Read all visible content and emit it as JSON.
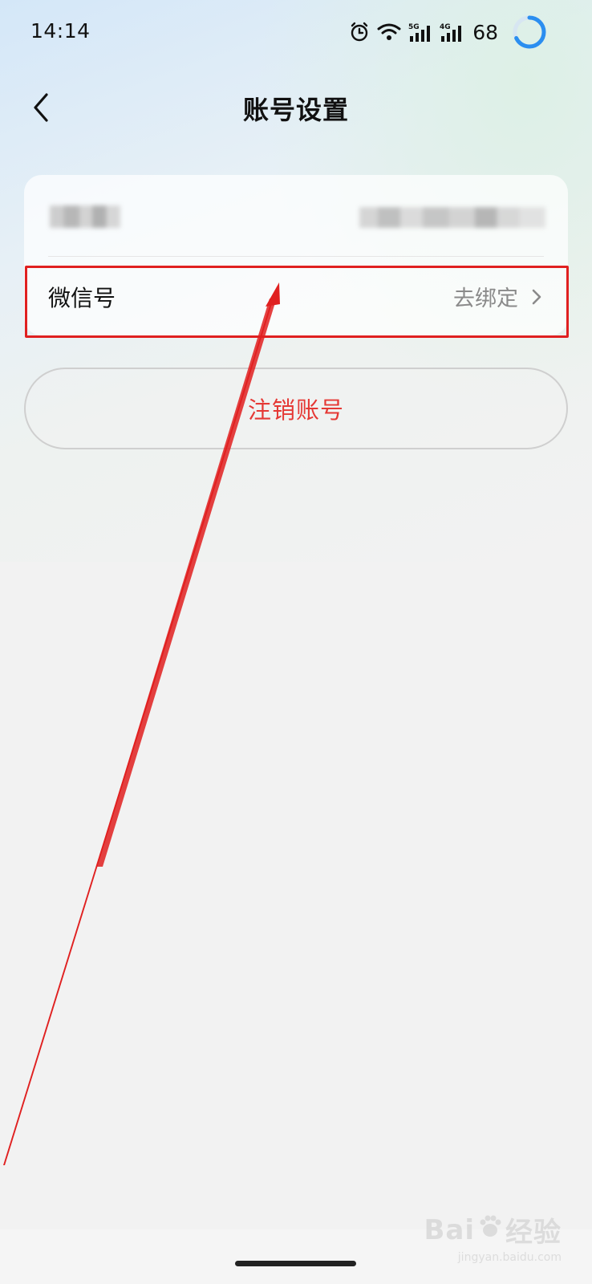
{
  "status_bar": {
    "time": "14:14",
    "signal_1_label": "5G",
    "signal_2_label": "4G",
    "battery": "68",
    "icons": [
      "alarm-icon",
      "wifi-icon",
      "signal-5g-icon",
      "signal-4g-icon",
      "battery-ring-icon"
    ]
  },
  "header": {
    "back_icon": "chevron-left-icon",
    "title": "账号设置"
  },
  "account_rows": {
    "phone_row": {
      "label_obscured": true,
      "value_obscured": true
    },
    "wechat_row": {
      "label": "微信号",
      "action": "去绑定",
      "icon": "chevron-right-icon"
    }
  },
  "deactivate_button": {
    "label": "注销账号"
  },
  "annotation": {
    "color": "#e02020"
  },
  "watermark": {
    "brand_left": "Bai",
    "brand_right": "经验",
    "url": "jingyan.baidu.com"
  }
}
